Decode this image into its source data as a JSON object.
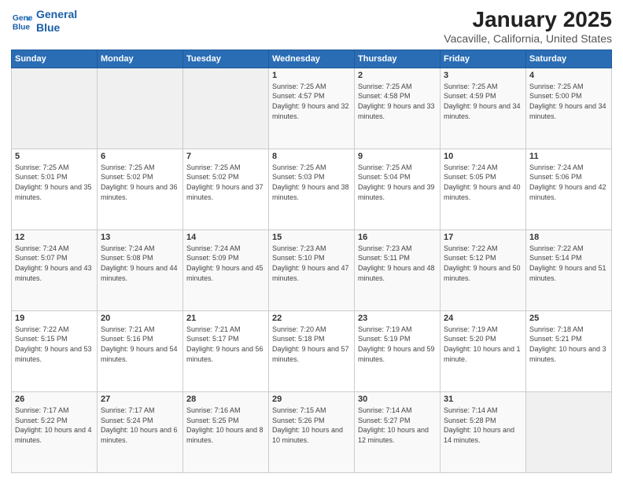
{
  "header": {
    "logo_line1": "General",
    "logo_line2": "Blue",
    "title": "January 2025",
    "subtitle": "Vacaville, California, United States"
  },
  "calendar": {
    "days_of_week": [
      "Sunday",
      "Monday",
      "Tuesday",
      "Wednesday",
      "Thursday",
      "Friday",
      "Saturday"
    ],
    "weeks": [
      [
        {
          "day": "",
          "empty": true
        },
        {
          "day": "",
          "empty": true
        },
        {
          "day": "",
          "empty": true
        },
        {
          "day": "1",
          "sunrise": "7:25 AM",
          "sunset": "4:57 PM",
          "daylight": "9 hours and 32 minutes."
        },
        {
          "day": "2",
          "sunrise": "7:25 AM",
          "sunset": "4:58 PM",
          "daylight": "9 hours and 33 minutes."
        },
        {
          "day": "3",
          "sunrise": "7:25 AM",
          "sunset": "4:59 PM",
          "daylight": "9 hours and 34 minutes."
        },
        {
          "day": "4",
          "sunrise": "7:25 AM",
          "sunset": "5:00 PM",
          "daylight": "9 hours and 34 minutes."
        }
      ],
      [
        {
          "day": "5",
          "sunrise": "7:25 AM",
          "sunset": "5:01 PM",
          "daylight": "9 hours and 35 minutes."
        },
        {
          "day": "6",
          "sunrise": "7:25 AM",
          "sunset": "5:02 PM",
          "daylight": "9 hours and 36 minutes."
        },
        {
          "day": "7",
          "sunrise": "7:25 AM",
          "sunset": "5:02 PM",
          "daylight": "9 hours and 37 minutes."
        },
        {
          "day": "8",
          "sunrise": "7:25 AM",
          "sunset": "5:03 PM",
          "daylight": "9 hours and 38 minutes."
        },
        {
          "day": "9",
          "sunrise": "7:25 AM",
          "sunset": "5:04 PM",
          "daylight": "9 hours and 39 minutes."
        },
        {
          "day": "10",
          "sunrise": "7:24 AM",
          "sunset": "5:05 PM",
          "daylight": "9 hours and 40 minutes."
        },
        {
          "day": "11",
          "sunrise": "7:24 AM",
          "sunset": "5:06 PM",
          "daylight": "9 hours and 42 minutes."
        }
      ],
      [
        {
          "day": "12",
          "sunrise": "7:24 AM",
          "sunset": "5:07 PM",
          "daylight": "9 hours and 43 minutes."
        },
        {
          "day": "13",
          "sunrise": "7:24 AM",
          "sunset": "5:08 PM",
          "daylight": "9 hours and 44 minutes."
        },
        {
          "day": "14",
          "sunrise": "7:24 AM",
          "sunset": "5:09 PM",
          "daylight": "9 hours and 45 minutes."
        },
        {
          "day": "15",
          "sunrise": "7:23 AM",
          "sunset": "5:10 PM",
          "daylight": "9 hours and 47 minutes."
        },
        {
          "day": "16",
          "sunrise": "7:23 AM",
          "sunset": "5:11 PM",
          "daylight": "9 hours and 48 minutes."
        },
        {
          "day": "17",
          "sunrise": "7:22 AM",
          "sunset": "5:12 PM",
          "daylight": "9 hours and 50 minutes."
        },
        {
          "day": "18",
          "sunrise": "7:22 AM",
          "sunset": "5:14 PM",
          "daylight": "9 hours and 51 minutes."
        }
      ],
      [
        {
          "day": "19",
          "sunrise": "7:22 AM",
          "sunset": "5:15 PM",
          "daylight": "9 hours and 53 minutes."
        },
        {
          "day": "20",
          "sunrise": "7:21 AM",
          "sunset": "5:16 PM",
          "daylight": "9 hours and 54 minutes."
        },
        {
          "day": "21",
          "sunrise": "7:21 AM",
          "sunset": "5:17 PM",
          "daylight": "9 hours and 56 minutes."
        },
        {
          "day": "22",
          "sunrise": "7:20 AM",
          "sunset": "5:18 PM",
          "daylight": "9 hours and 57 minutes."
        },
        {
          "day": "23",
          "sunrise": "7:19 AM",
          "sunset": "5:19 PM",
          "daylight": "9 hours and 59 minutes."
        },
        {
          "day": "24",
          "sunrise": "7:19 AM",
          "sunset": "5:20 PM",
          "daylight": "10 hours and 1 minute."
        },
        {
          "day": "25",
          "sunrise": "7:18 AM",
          "sunset": "5:21 PM",
          "daylight": "10 hours and 3 minutes."
        }
      ],
      [
        {
          "day": "26",
          "sunrise": "7:17 AM",
          "sunset": "5:22 PM",
          "daylight": "10 hours and 4 minutes."
        },
        {
          "day": "27",
          "sunrise": "7:17 AM",
          "sunset": "5:24 PM",
          "daylight": "10 hours and 6 minutes."
        },
        {
          "day": "28",
          "sunrise": "7:16 AM",
          "sunset": "5:25 PM",
          "daylight": "10 hours and 8 minutes."
        },
        {
          "day": "29",
          "sunrise": "7:15 AM",
          "sunset": "5:26 PM",
          "daylight": "10 hours and 10 minutes."
        },
        {
          "day": "30",
          "sunrise": "7:14 AM",
          "sunset": "5:27 PM",
          "daylight": "10 hours and 12 minutes."
        },
        {
          "day": "31",
          "sunrise": "7:14 AM",
          "sunset": "5:28 PM",
          "daylight": "10 hours and 14 minutes."
        },
        {
          "day": "",
          "empty": true
        }
      ]
    ]
  }
}
